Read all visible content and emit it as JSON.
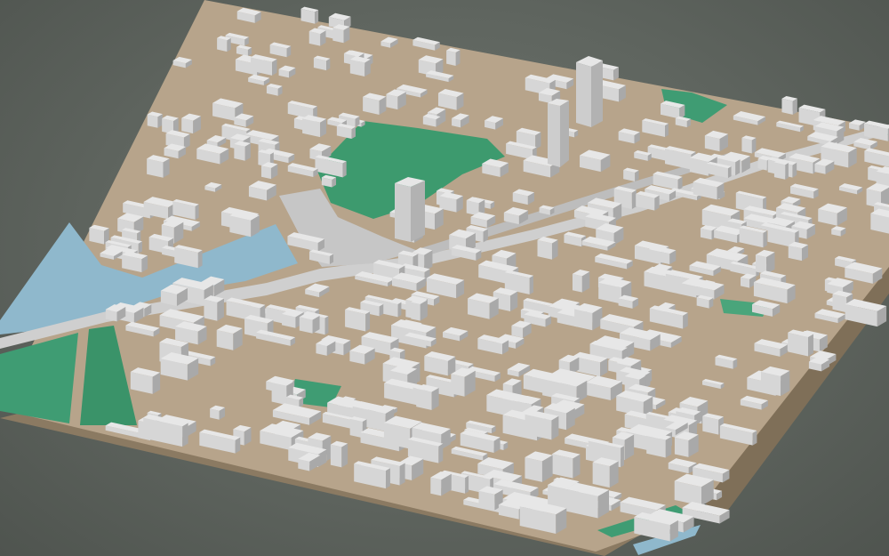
{
  "scene": {
    "view": "3d-city-block-model",
    "colors": {
      "background": "#616761",
      "base_top": "#b7a48b",
      "base_side": "#8b7a62",
      "building": "#d6d6d6",
      "roof": "#e7e7e7",
      "building_shade": "#a9a9a9",
      "park": "#3d9a6e",
      "water": "#8fb8cc",
      "road": "#cfcfcf",
      "plaza": "#c6c6c6"
    }
  }
}
